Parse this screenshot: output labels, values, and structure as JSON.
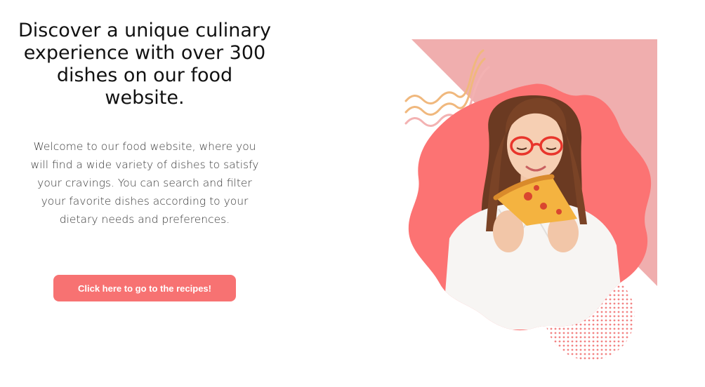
{
  "hero": {
    "headline": "Discover a unique culinary experience with over 300 dishes on our food website.",
    "intro": "Welcome to our food website, where you will find a wide variety of dishes to satisfy your cravings. You can search and filter your favorite dishes according to your dietary needs and preferences.",
    "cta_label": "Click here to go to the recipes!"
  },
  "colors": {
    "accent": "#f77272",
    "triangle": "#f0aeae",
    "blob": "#fc7373",
    "squiggle_orange": "#f0b87d",
    "squiggle_pink": "#f3b2b2",
    "dots": "#f06e6e"
  },
  "illustration": {
    "subject": "smiling-woman-eating-pizza",
    "decorations": [
      "pink-triangle",
      "wavy-blob",
      "squiggle-lines",
      "halftone-dots"
    ]
  }
}
